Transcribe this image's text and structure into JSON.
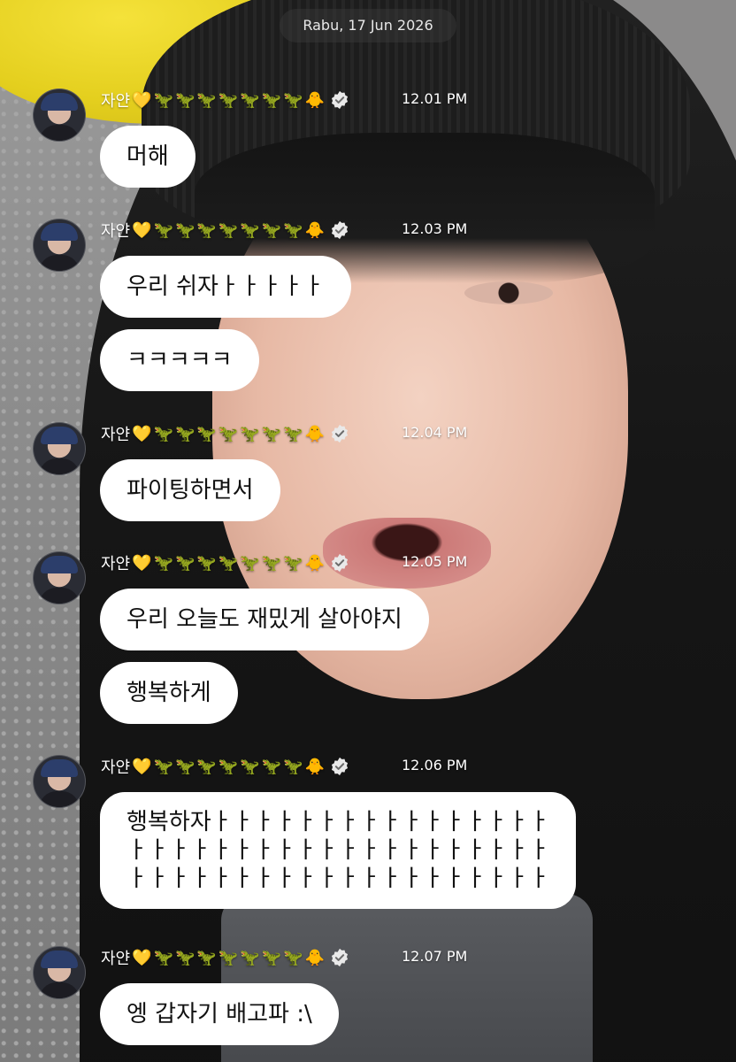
{
  "date_label": "Rabu, 17 Jun 2026",
  "sender": {
    "name": "자얀",
    "emoji_badges": [
      "💛",
      "🦖",
      "🦖",
      "🦖",
      "🦖",
      "🦖",
      "🦖",
      "🦖",
      "🐥"
    ],
    "verified_icon": "verified-badge-icon"
  },
  "groups": [
    {
      "time": "12.01 PM",
      "messages": [
        "머해"
      ]
    },
    {
      "time": "12.03 PM",
      "messages": [
        "우리 쉬자ㅏㅏㅏㅏㅏ",
        "ㅋㅋㅋㅋㅋ"
      ]
    },
    {
      "time": "12.04 PM",
      "messages": [
        "파이팅하면서"
      ]
    },
    {
      "time": "12.05 PM",
      "messages": [
        "우리 오늘도 재밌게 살아야지",
        "행복하게"
      ]
    },
    {
      "time": "12.06 PM",
      "messages": [
        "행복하자ㅏㅏㅏㅏㅏㅏㅏㅏㅏㅏㅏㅏㅏㅏㅏㅏ\nㅏㅏㅏㅏㅏㅏㅏㅏㅏㅏㅏㅏㅏㅏㅏㅏㅏㅏㅏㅏ\nㅏㅏㅏㅏㅏㅏㅏㅏㅏㅏㅏㅏㅏㅏㅏㅏㅏㅏㅏㅏ"
      ]
    },
    {
      "time": "12.07 PM",
      "messages": [
        "엥 갑자기 배고파 :\\"
      ]
    }
  ]
}
